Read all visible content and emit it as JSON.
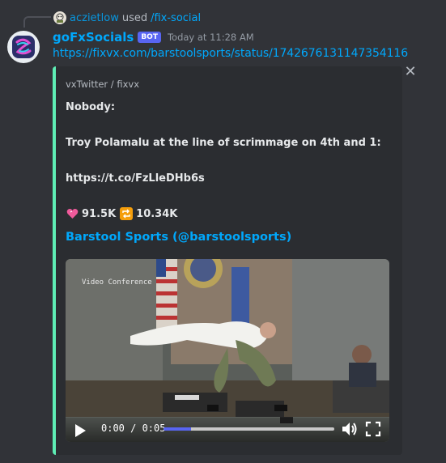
{
  "command": {
    "user": "aczietlow",
    "used_text": "used",
    "command_name": "/fix-social"
  },
  "message": {
    "username": "goFxSocials",
    "bot_badge": "BOT",
    "timestamp": "Today at 11:28 AM",
    "link": "https://fixvx.com/barstoolsports/status/1742676131147354116"
  },
  "embed": {
    "accent_color": "#5eeeb5",
    "provider": "vxTwitter / fixvx",
    "lines": [
      "Nobody:",
      "Troy Polamalu at the line of scrimmage on 4th and 1:",
      "https://t.co/FzLleDHb6s"
    ],
    "likes": "91.5K",
    "retweets": "10.34K",
    "author": "Barstool Sports (@barstoolsports)",
    "close_icon": "close-icon"
  },
  "video": {
    "overlay_text": "Video Conference",
    "time_current": "0:00",
    "time_total": "0:05",
    "time_display": "0:00 / 0:05",
    "progress_fraction": 0.16,
    "colors": {
      "progress": "#5865f2",
      "link": "#00a8fc",
      "bot": "#5865f2"
    }
  }
}
